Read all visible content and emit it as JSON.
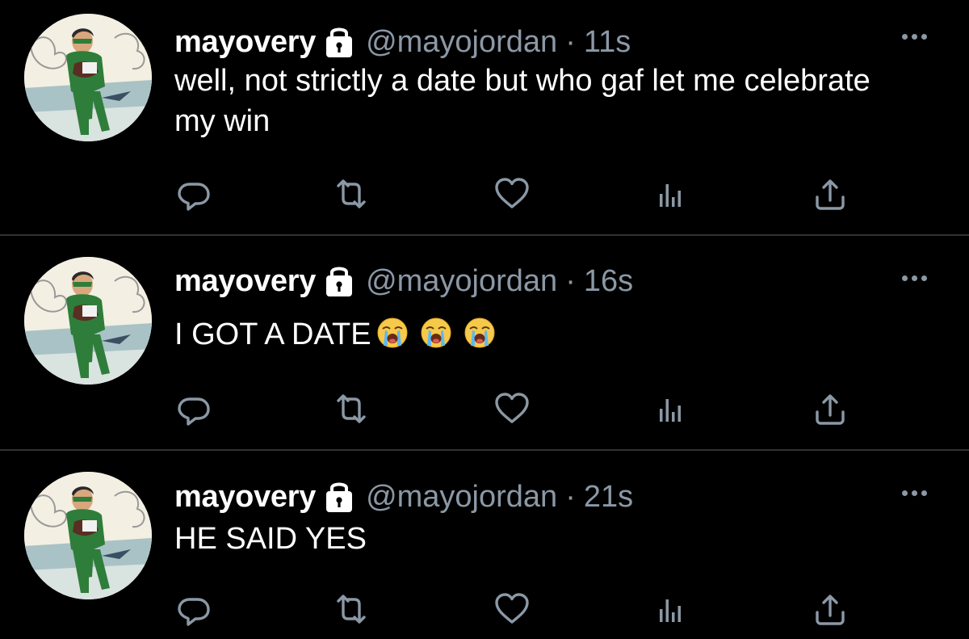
{
  "tweets": [
    {
      "display_name": "mayovery",
      "handle": "@mayojordan",
      "separator": "·",
      "time": "11s",
      "text": "well, not strictly a date but who gaf let me celebrate my win",
      "emojis": []
    },
    {
      "display_name": "mayovery",
      "handle": "@mayojordan",
      "separator": "·",
      "time": "16s",
      "text": "I GOT A DATE",
      "emojis": [
        "loudly-crying-face",
        "loudly-crying-face",
        "loudly-crying-face"
      ]
    },
    {
      "display_name": "mayovery",
      "handle": "@mayojordan",
      "separator": "·",
      "time": "21s",
      "text": "HE SAID YES",
      "emojis": []
    }
  ],
  "icons": {
    "protected": "lock-icon",
    "menu": "more-icon",
    "actions": [
      "reply-icon",
      "retweet-icon",
      "like-icon",
      "analytics-icon",
      "share-icon"
    ]
  },
  "colors": {
    "background": "#000000",
    "text": "#ffffff",
    "secondary": "#8b98a5",
    "divider": "#2f3336"
  }
}
